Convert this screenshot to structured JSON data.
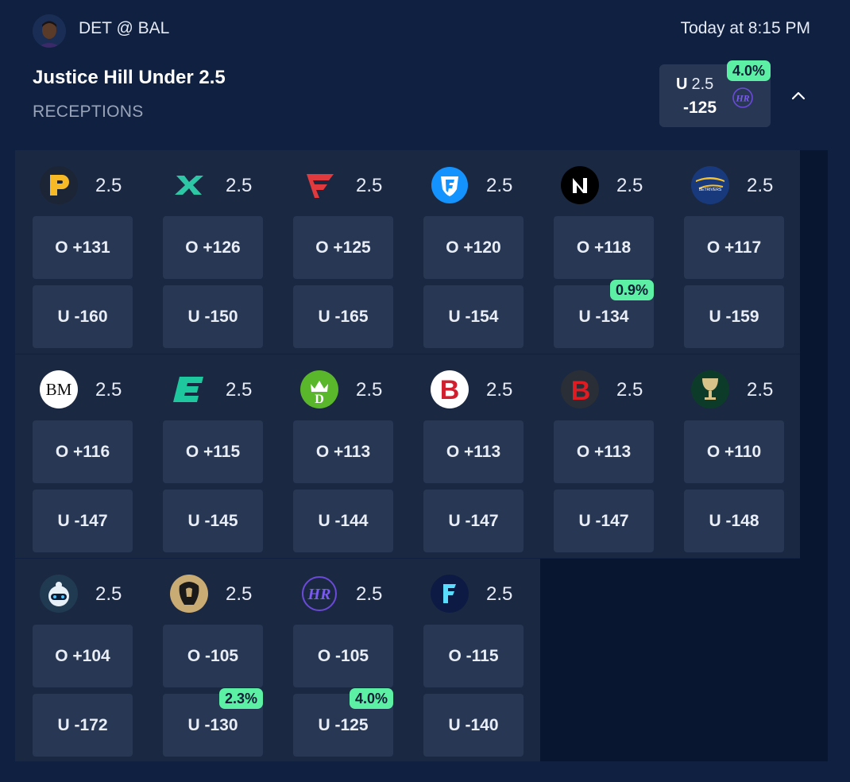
{
  "header": {
    "matchup": "DET @ BAL",
    "time": "Today at 8:15 PM",
    "title": "Justice Hill Under 2.5",
    "market": "RECEPTIONS",
    "best": {
      "side": "U",
      "line": "2.5",
      "odds": "-125",
      "pct": "4.0%",
      "book_icon": "hardrock-logo-icon"
    }
  },
  "books": [
    {
      "name": "prizepicks",
      "icon": "prizepicks-logo-icon",
      "line": "2.5",
      "over": "O +131",
      "under": "U -160"
    },
    {
      "name": "betonline",
      "icon": "x-logo-icon",
      "line": "2.5",
      "over": "O +126",
      "under": "U -150"
    },
    {
      "name": "fanatics",
      "icon": "fanatics-logo-icon",
      "line": "2.5",
      "over": "O +125",
      "under": "U -165"
    },
    {
      "name": "fanduel",
      "icon": "fanduel-shield-icon",
      "line": "2.5",
      "over": "O +120",
      "under": "U -154"
    },
    {
      "name": "novig",
      "icon": "novig-logo-icon",
      "line": "2.5",
      "over": "O +118",
      "under": "U -134",
      "pct": "0.9%"
    },
    {
      "name": "betrivers",
      "icon": "betrivers-logo-icon",
      "line": "2.5",
      "over": "O +117",
      "under": "U -159"
    },
    {
      "name": "bookmaker",
      "icon": "bm-logo-icon",
      "line": "2.5",
      "over": "O +116",
      "under": "U -147"
    },
    {
      "name": "espnbet",
      "icon": "e-logo-icon",
      "line": "2.5",
      "over": "O +115",
      "under": "U -145"
    },
    {
      "name": "draftkings",
      "icon": "draftkings-crown-icon",
      "line": "2.5",
      "over": "O +113",
      "under": "U -144"
    },
    {
      "name": "bally",
      "icon": "b-circle-logo-icon",
      "line": "2.5",
      "over": "O +113",
      "under": "U -147"
    },
    {
      "name": "betmgm-b",
      "icon": "b-red-logo-icon",
      "line": "2.5",
      "over": "O +113",
      "under": "U -147"
    },
    {
      "name": "caesars",
      "icon": "goblet-logo-icon",
      "line": "2.5",
      "over": "O +110",
      "under": "U -148"
    },
    {
      "name": "sleeper",
      "icon": "robot-logo-icon",
      "line": "2.5",
      "over": "O +104",
      "under": "U -172"
    },
    {
      "name": "betmgm",
      "icon": "lion-logo-icon",
      "line": "2.5",
      "over": "O -105",
      "under": "U -130",
      "pct": "2.3%"
    },
    {
      "name": "hardrock",
      "icon": "hardrock-logo-icon",
      "line": "2.5",
      "over": "O -105",
      "under": "U -125",
      "pct": "4.0%"
    },
    {
      "name": "fliff",
      "icon": "f-logo-icon",
      "line": "2.5",
      "over": "O -115",
      "under": "U -140"
    }
  ]
}
